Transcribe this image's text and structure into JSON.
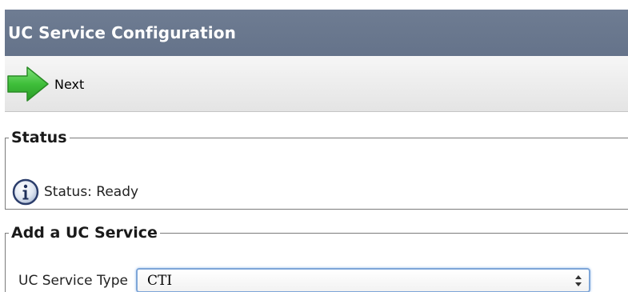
{
  "window": {
    "title": "UC Service Configuration"
  },
  "toolbar": {
    "next_label": "Next",
    "next_icon": "arrow-right-icon",
    "next_icon_color": "#3db83a"
  },
  "status_section": {
    "legend": "Status",
    "icon": "info-icon",
    "text": "Status: Ready"
  },
  "add_service_section": {
    "legend": "Add a UC Service",
    "field_label": "UC Service Type",
    "selected_value": "CTI"
  },
  "colors": {
    "title_bar": "#6b798f",
    "toolbar_bg": "#ececec",
    "select_focus": "#7ea6d8"
  }
}
